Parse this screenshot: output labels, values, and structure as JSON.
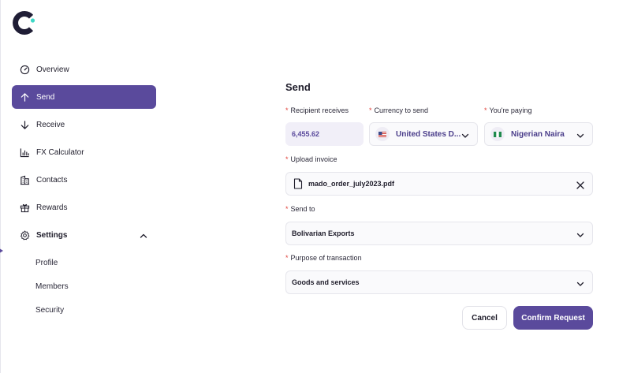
{
  "brand": {
    "logo_icon": "brand-c-logo",
    "accent": "#5a4a9c",
    "logo_color": "#1f1d35",
    "logo_dot": "#3fd7c6"
  },
  "sidebar": {
    "items": [
      {
        "label": "Overview",
        "icon": "gauge-icon",
        "active": false
      },
      {
        "label": "Send",
        "icon": "arrow-up-icon",
        "active": true
      },
      {
        "label": "Receive",
        "icon": "arrow-down-icon",
        "active": false
      },
      {
        "label": "FX Calculator",
        "icon": "bar-chart-icon",
        "active": false
      },
      {
        "label": "Contacts",
        "icon": "building-icon",
        "active": false
      },
      {
        "label": "Rewards",
        "icon": "gift-icon",
        "active": false
      },
      {
        "label": "Settings",
        "icon": "gear-icon",
        "active": false,
        "expanded": true
      }
    ],
    "settings_sub": [
      {
        "label": "Profile"
      },
      {
        "label": "Members"
      },
      {
        "label": "Security"
      }
    ]
  },
  "form": {
    "title": "Send",
    "recipient_receives": {
      "label": "Recipient receives",
      "value": "6,455.62"
    },
    "currency_to_send": {
      "label": "Currency to send",
      "value": "United States D...",
      "flag": "us-flag-icon"
    },
    "you_are_paying": {
      "label": "You're paying",
      "value": "Nigerian Naira",
      "flag": "ng-flag-icon"
    },
    "upload_invoice": {
      "label": "Upload invoice",
      "file_name": "mado_order_july2023.pdf"
    },
    "send_to": {
      "label": "Send to",
      "value": "Bolivarian Exports"
    },
    "purpose": {
      "label": "Purpose of transaction",
      "value": "Goods and services"
    },
    "required_mark": "*",
    "cancel_label": "Cancel",
    "confirm_label": "Confirm Request"
  }
}
